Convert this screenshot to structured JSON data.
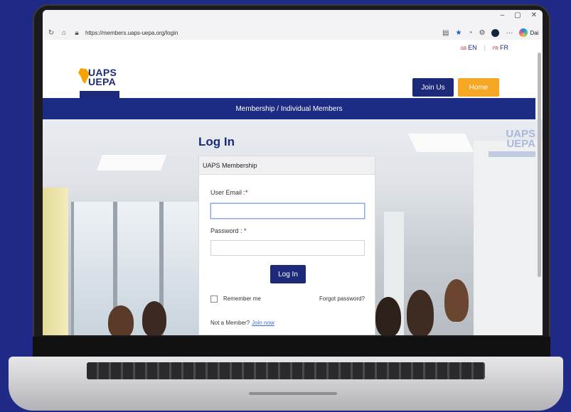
{
  "browser": {
    "url": "https://members.uaps-uepa.org/login",
    "window_controls": [
      "–",
      "▢",
      "✕"
    ],
    "profile_label": "Dai"
  },
  "header": {
    "lang_en": "EN",
    "lang_fr": "FR",
    "lang_en_flag": "GB",
    "lang_fr_flag": "FR",
    "logo_line1": "UAPS",
    "logo_line2": "UEPA",
    "join_us": "Join Us",
    "home": "Home"
  },
  "breadcrumb": "Membership / Individual Members",
  "watermark": {
    "line1": "UAPS",
    "line2": "UEPA"
  },
  "login": {
    "title": "Log In",
    "panel_title": "UAPS Membership",
    "email_label": "User Email :*",
    "email_value": "",
    "password_label": "Password : *",
    "password_value": "",
    "submit": "Log In",
    "remember": "Remember me",
    "forgot": "Forgot password?",
    "not_member": "Not a Member?",
    "join_now": "Join now"
  },
  "colors": {
    "brand_blue": "#1d2a7a",
    "accent_orange": "#f5a623",
    "page_bg": "#1f2a86"
  }
}
